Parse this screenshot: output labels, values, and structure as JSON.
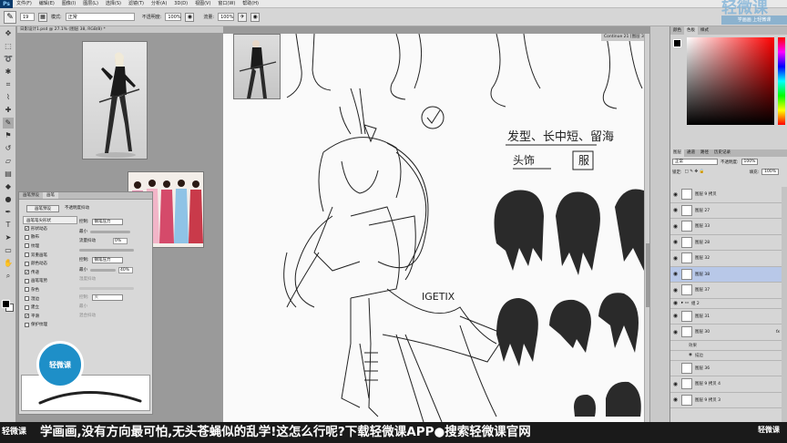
{
  "menubar": {
    "app_logo": "Ps",
    "items": [
      "文件(F)",
      "编辑(E)",
      "图像(I)",
      "图层(L)",
      "选择(S)",
      "滤镜(T)",
      "分析(A)",
      "3D(D)",
      "视图(V)",
      "窗口(W)",
      "帮助(H)"
    ]
  },
  "options": {
    "brush_size": "19",
    "mode_label": "模式:",
    "mode_value": "正常",
    "opacity_label": "不透明度:",
    "opacity_value": "100%",
    "flow_label": "流量:",
    "flow_value": "100%"
  },
  "document": {
    "tab_title": "日影设计1.psd @ 27.1% (图层 38, RGB/8) *",
    "tab2_title": "Continue 21 [图层 3]"
  },
  "brush_panel": {
    "tabs": [
      "画笔预设",
      "画笔"
    ],
    "preset_button": "画笔预设",
    "opacity_jitter_label": "不透明度抖动",
    "list_header": "画笔笔尖形状",
    "items": [
      {
        "label": "形状动态",
        "checked": true
      },
      {
        "label": "散布",
        "checked": false
      },
      {
        "label": "纹理",
        "checked": false
      },
      {
        "label": "双重画笔",
        "checked": false
      },
      {
        "label": "颜色动态",
        "checked": false
      },
      {
        "label": "传递",
        "checked": true
      },
      {
        "label": "画笔笔势",
        "checked": false
      },
      {
        "label": "杂色",
        "checked": false
      },
      {
        "label": "湿边",
        "checked": false
      },
      {
        "label": "建立",
        "checked": false
      },
      {
        "label": "平滑",
        "checked": true
      },
      {
        "label": "保护纹理",
        "checked": false
      }
    ],
    "control_label": "控制:",
    "control_value": "钢笔压力",
    "min_label": "最小",
    "value_a": "0%",
    "value_b": "40%",
    "flow_jitter_label": "流量抖动",
    "wet_label": "湿度抖动",
    "mix_label": "混合抖动",
    "off_value": "关"
  },
  "canvas_notes": {
    "line1": "发型、长中短、留海",
    "line2": "头饰",
    "line3": "服",
    "signature": "IGETIX"
  },
  "color_panel": {
    "tabs": [
      "颜色",
      "色板",
      "样式"
    ]
  },
  "layers_panel": {
    "tabs": [
      "图层",
      "通道",
      "路径",
      "历史记录"
    ],
    "blend_mode": "正常",
    "opacity_label": "不透明度:",
    "opacity_value": "100%",
    "lock_label": "锁定:",
    "fill_label": "填充:",
    "fill_value": "100%",
    "layers": [
      {
        "name": "图层 9 拷贝",
        "sel": false,
        "fx": false
      },
      {
        "name": "图层 27",
        "sel": false,
        "fx": false
      },
      {
        "name": "图层 33",
        "sel": false,
        "fx": false
      },
      {
        "name": "图层 28",
        "sel": false,
        "fx": false
      },
      {
        "name": "图层 32",
        "sel": false,
        "fx": false
      },
      {
        "name": "图层 38",
        "sel": true,
        "fx": false
      },
      {
        "name": "图层 37",
        "sel": false,
        "fx": false
      },
      {
        "name": "组 2",
        "sel": false,
        "fx": false
      },
      {
        "name": "图层 31",
        "sel": false,
        "fx": false
      },
      {
        "name": "图层 30",
        "sel": false,
        "fx": true
      }
    ],
    "effects_label": "效果",
    "effect_item": "描边",
    "layers_after": [
      {
        "name": "图层 36",
        "sel": false,
        "fx": false
      },
      {
        "name": "图层 9 拷贝 4",
        "sel": false,
        "fx": false
      },
      {
        "name": "图层 9 拷贝 3",
        "sel": false,
        "fx": false
      }
    ],
    "fx_label": "fx"
  },
  "watermark": {
    "logo_text": "轻微课",
    "logo_sub": "学画画 上轻微课",
    "badge_text": "轻微课"
  },
  "subtitle": {
    "left_logo": "轻微课",
    "text": "学画画,没有方向最可怕,无头苍蝇似的乱学!这怎么行呢?下载轻微课APP●搜索轻微课官网",
    "right_logo": "轻微课"
  }
}
